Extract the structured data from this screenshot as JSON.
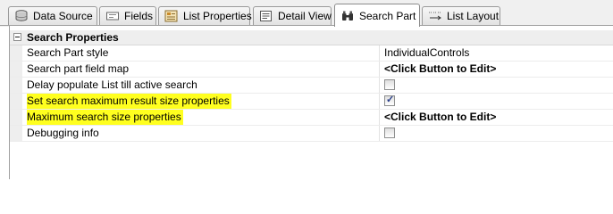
{
  "tabs": [
    {
      "label": "Data Source",
      "icon": "database-icon",
      "active": false
    },
    {
      "label": "Fields",
      "icon": "fields-icon",
      "active": false
    },
    {
      "label": "List Properties",
      "icon": "list-properties-icon",
      "active": false
    },
    {
      "label": "Detail View",
      "icon": "detail-view-icon",
      "active": false
    },
    {
      "label": "Search Part",
      "icon": "binoculars-icon",
      "active": true
    },
    {
      "label": "List Layout",
      "icon": "list-layout-icon",
      "active": false
    }
  ],
  "category": {
    "title": "Search Properties",
    "expanded": true
  },
  "properties": [
    {
      "name": "Search Part style",
      "value": "IndividualControls",
      "type": "text",
      "highlighted": false
    },
    {
      "name": "Search part field map",
      "value": "<Click Button to Edit>",
      "type": "editor",
      "highlighted": false
    },
    {
      "name": "Delay populate List till active search",
      "checked": false,
      "type": "checkbox",
      "highlighted": false
    },
    {
      "name": "Set search maximum result size properties",
      "checked": true,
      "type": "checkbox",
      "highlighted": true
    },
    {
      "name": "Maximum search size properties",
      "value": "<Click Button to Edit>",
      "type": "editor",
      "highlighted": true
    },
    {
      "name": "Debugging info",
      "checked": false,
      "type": "checkbox",
      "highlighted": false
    }
  ],
  "colors": {
    "highlight": "#ffff1f",
    "grid_gutter": "#eeeeee"
  }
}
